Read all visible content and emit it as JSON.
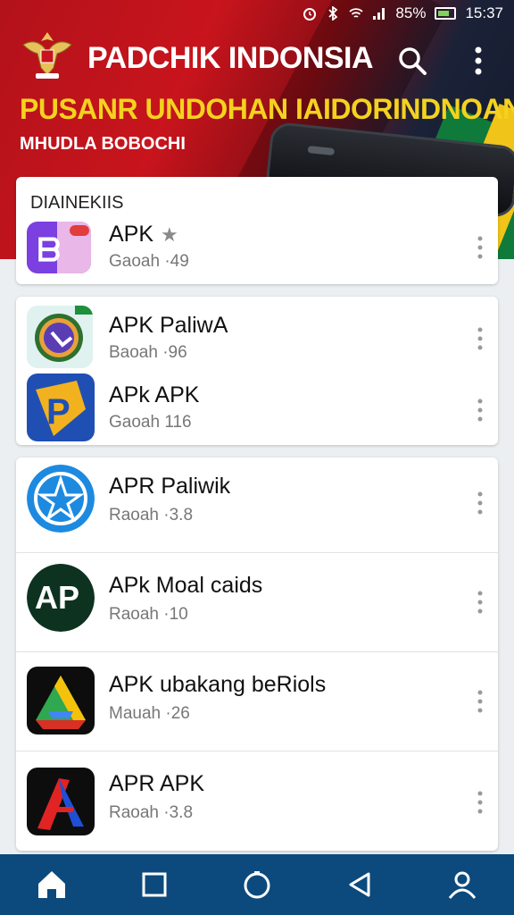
{
  "status": {
    "battery": "85%",
    "time": "15:37"
  },
  "header": {
    "title": "PADCHIK INDONSIA",
    "banner_main": "PUSANR UNDOHAN IAIDORINDNOAN",
    "banner_sub": "MHUDLA BOBOCHI"
  },
  "sections": [
    {
      "heading": "DIAINEKIIS",
      "items": [
        {
          "name": "APK",
          "sub": "Gaoah ·49",
          "starred": true,
          "icon": "purple-b-app-icon"
        }
      ]
    },
    {
      "heading": "",
      "items": [
        {
          "name": "APK PaliwA",
          "sub": "Baoah ·96",
          "icon": "green-circle-app-icon"
        },
        {
          "name": "APk APK",
          "sub": "Gaoah 116",
          "icon": "yellow-p-app-icon"
        }
      ]
    },
    {
      "heading": "",
      "items": [
        {
          "name": "APR Paliwik",
          "sub": "Raoah ·3.8",
          "icon": "blue-star-app-icon"
        },
        {
          "name": "APk Moal caids",
          "sub": "Raoah ·10",
          "icon": "ap-logo-app-icon"
        },
        {
          "name": "APK ubakang beRiols",
          "sub": "Mauah ·26",
          "icon": "drive-triangle-app-icon"
        },
        {
          "name": "APR APK",
          "sub": "Raoah ·3.8",
          "icon": "red-a-app-icon"
        }
      ]
    }
  ],
  "bottom_nav": [
    "home-icon",
    "recents-square-icon",
    "circle-icon",
    "back-triangle-icon",
    "profile-icon"
  ],
  "colors": {
    "header_red": "#c8141c",
    "banner_yellow": "#f4d21f",
    "nav_blue": "#0c4a7d"
  }
}
